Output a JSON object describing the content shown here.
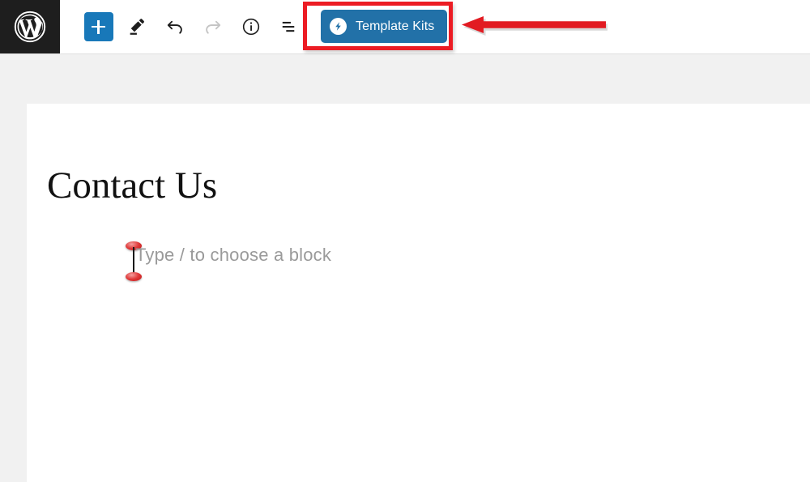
{
  "app": {
    "name": "WordPress Block Editor",
    "logo_icon": "wordpress-logo-icon"
  },
  "toolbar": {
    "add_block": {
      "label": "Add block",
      "icon": "plus-icon",
      "accent_color": "#1878b9"
    },
    "tools": [
      {
        "name": "edit-tool",
        "label": "Edit",
        "icon": "pencil-icon"
      },
      {
        "name": "undo",
        "label": "Undo",
        "icon": "undo-arrow-icon",
        "enabled": true
      },
      {
        "name": "redo",
        "label": "Redo",
        "icon": "redo-arrow-icon",
        "enabled": false
      },
      {
        "name": "details",
        "label": "Details",
        "icon": "info-circle-icon"
      },
      {
        "name": "list-view",
        "label": "List view",
        "icon": "list-view-icon"
      }
    ],
    "template_kits": {
      "label": "Template Kits",
      "icon": "envato-bolt-icon",
      "button_color": "#2271a8"
    }
  },
  "annotation": {
    "highlight_color": "#ec1c24",
    "arrow_icon": "left-pointing-arrow",
    "target": "Template Kits"
  },
  "editor": {
    "post_title": "Contact Us",
    "block_placeholder": "Type / to choose a block",
    "caret": {
      "icon": "text-caret-with-handles",
      "handle_color": "#e03b3b"
    },
    "canvas_background": "#f1f1f1",
    "page_background": "#ffffff"
  }
}
